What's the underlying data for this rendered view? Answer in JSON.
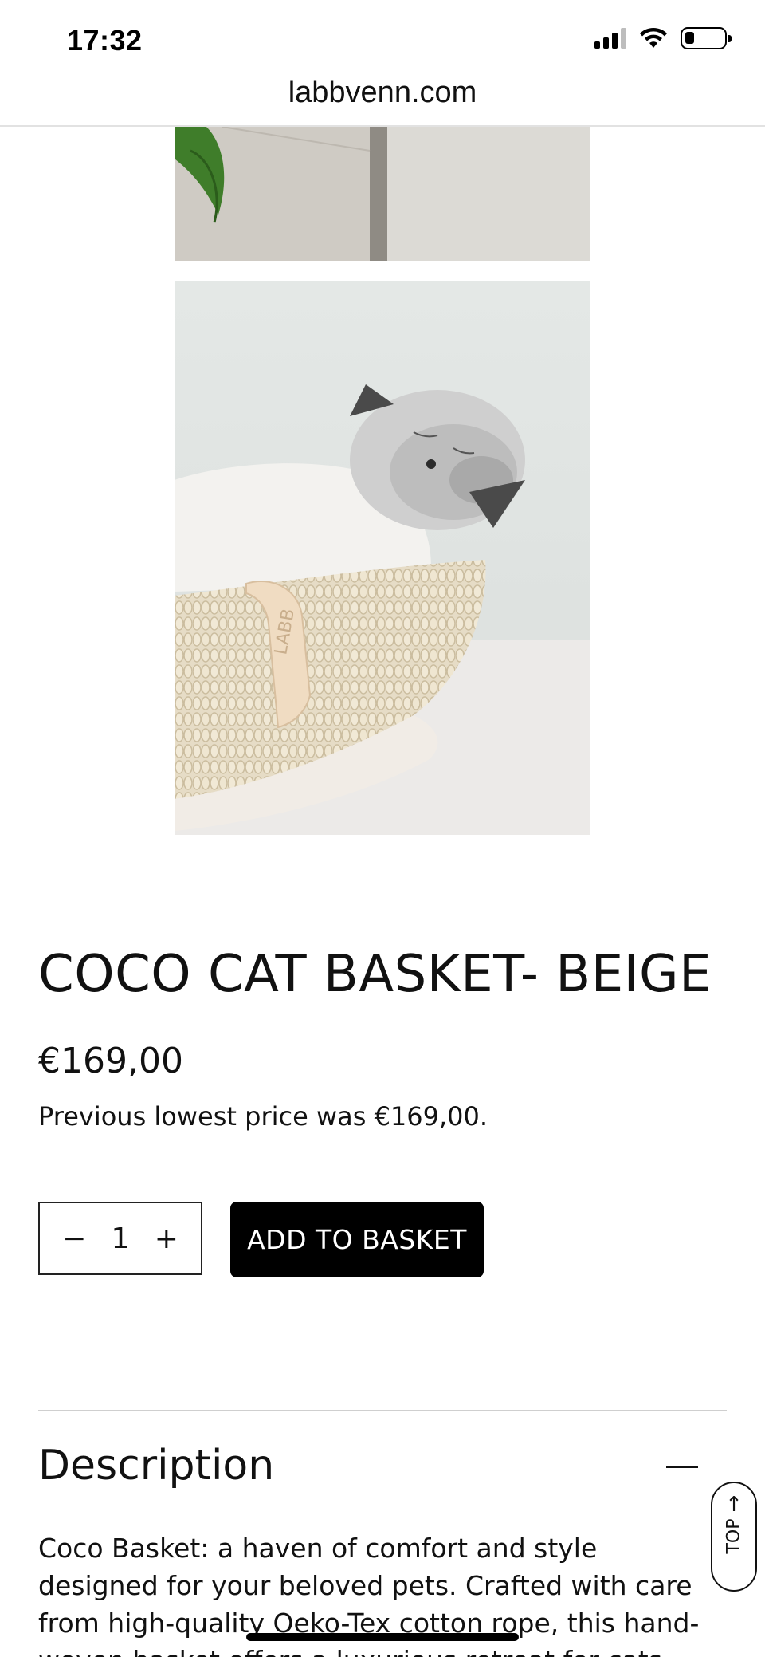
{
  "status_bar": {
    "time": "17:32",
    "icons": [
      "cellular-signal-icon",
      "wifi-icon",
      "battery-icon"
    ]
  },
  "browser": {
    "url": "labbvenn.com"
  },
  "gallery": {
    "images": [
      "interior-cabinet-plant-photo",
      "cat-in-basket-photo"
    ],
    "basket_tag_text": "LABB"
  },
  "product": {
    "title": "COCO CAT BASKET- BEIGE",
    "price": "€169,00",
    "previous_price_note": "Previous lowest price was €169,00.",
    "quantity": {
      "decrement_label": "−",
      "value": "1",
      "increment_label": "+"
    },
    "add_to_basket_label": "ADD TO BASKET"
  },
  "description": {
    "heading": "Description",
    "text": "Coco Basket: a haven of comfort and style designed for your beloved pets. Crafted with care from high-quality Oeko-Tex cotton rope, this hand-woven basket offers a luxurious retreat for cats."
  },
  "back_to_top": {
    "arrow": "↑",
    "label": "TOP"
  },
  "colors": {
    "button_background": "#000000",
    "button_text": "#ffffff",
    "divider": "#cfcfcf"
  }
}
